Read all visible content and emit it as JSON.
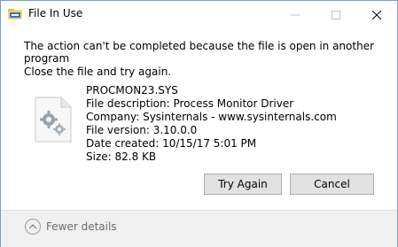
{
  "window": {
    "title": "File In Use"
  },
  "message": {
    "line1": "The action can't be completed because the file is open in another program",
    "line2": "Close the file and try again."
  },
  "file": {
    "name": "PROCMON23.SYS",
    "description": "File description: Process Monitor Driver",
    "company": "Company: Sysinternals - www.sysinternals.com",
    "version": "File version: 3.10.0.0",
    "date_created": "Date created: 10/15/17 5:01 PM",
    "size": "Size: 82.8 KB",
    "icon": "system-file-gears-icon"
  },
  "buttons": {
    "try_again": "Try Again",
    "cancel": "Cancel"
  },
  "footer": {
    "fewer_details": "Fewer details"
  },
  "colors": {
    "border": "#7a9ecb",
    "footer_bg": "#f0f0f0",
    "button_bg": "#e1e1e1"
  }
}
